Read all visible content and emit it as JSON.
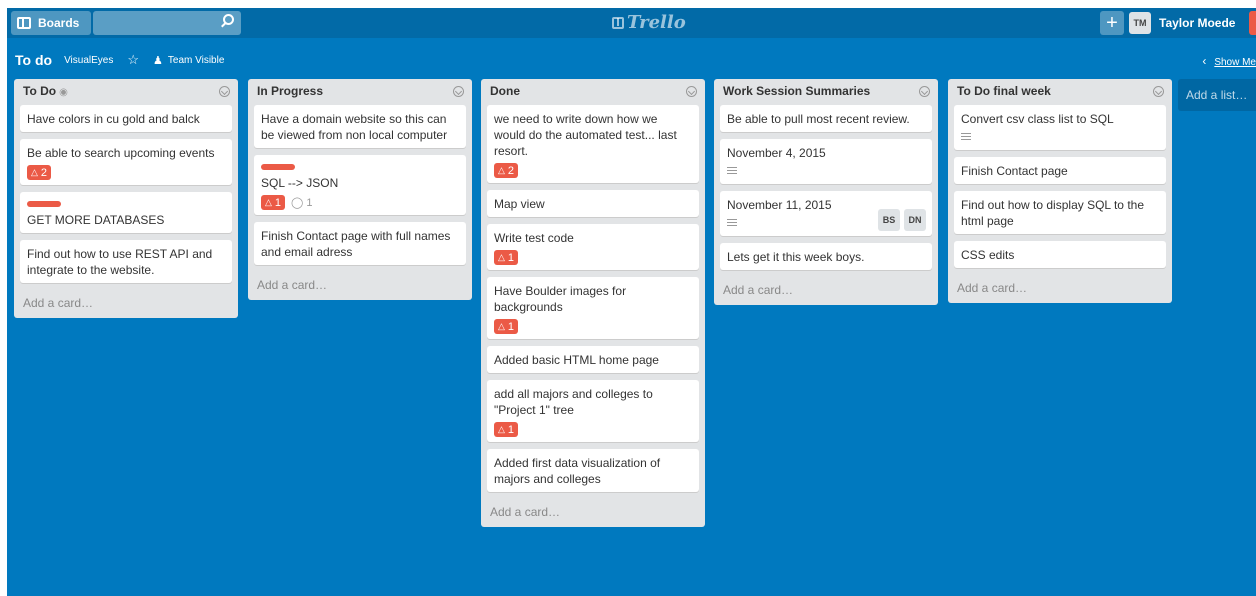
{
  "header": {
    "boards_label": "Boards",
    "search_placeholder": "",
    "logo": "Trello",
    "add_button": "+",
    "user_initials": "TM",
    "user_name": "Taylor Moede"
  },
  "board": {
    "title": "To do",
    "org": "VisualEyes",
    "star": "☆",
    "team_label": "Team Visible",
    "show_menu": "Show Me",
    "add_card_label": "Add a card…",
    "add_list_label": "Add a list…"
  },
  "lists": [
    {
      "title": "To Do",
      "cards": [
        {
          "text": "Have colors in cu gold and balck"
        },
        {
          "text": "Be able to search upcoming events",
          "due": "2"
        },
        {
          "text": "GET MORE DATABASES",
          "label": true
        },
        {
          "text": "Find out how to use REST API and integrate to the website."
        }
      ]
    },
    {
      "title": "In Progress",
      "cards": [
        {
          "text": "Have a domain website so this can be viewed from non local computer"
        },
        {
          "text": "SQL --> JSON",
          "label": true,
          "due": "1",
          "comments": "1"
        },
        {
          "text": "Finish Contact page with full names and email adress"
        }
      ]
    },
    {
      "title": "Done",
      "cards": [
        {
          "text": "we need to write down how we would do the automated test... last resort.",
          "due": "2"
        },
        {
          "text": "Map view"
        },
        {
          "text": "Write test code",
          "due": "1"
        },
        {
          "text": "Have Boulder images for backgrounds",
          "due": "1"
        },
        {
          "text": "Added basic HTML home page"
        },
        {
          "text": "add all majors and colleges to \"Project 1\" tree",
          "due": "1"
        },
        {
          "text": "Added first data visualization of majors and colleges"
        }
      ]
    },
    {
      "title": "Work Session Summaries",
      "cards": [
        {
          "text": "Be able to pull most recent review."
        },
        {
          "text": "November 4, 2015",
          "desc": true
        },
        {
          "text": "November 11, 2015",
          "desc": true,
          "members": [
            "BS",
            "DN"
          ]
        },
        {
          "text": "Lets get it this week boys."
        }
      ]
    },
    {
      "title": "To Do final week",
      "cards": [
        {
          "text": "Convert csv class list to SQL",
          "desc": true
        },
        {
          "text": "Finish Contact page"
        },
        {
          "text": "Find out how to display SQL to the html page"
        },
        {
          "text": "CSS edits"
        }
      ]
    }
  ]
}
